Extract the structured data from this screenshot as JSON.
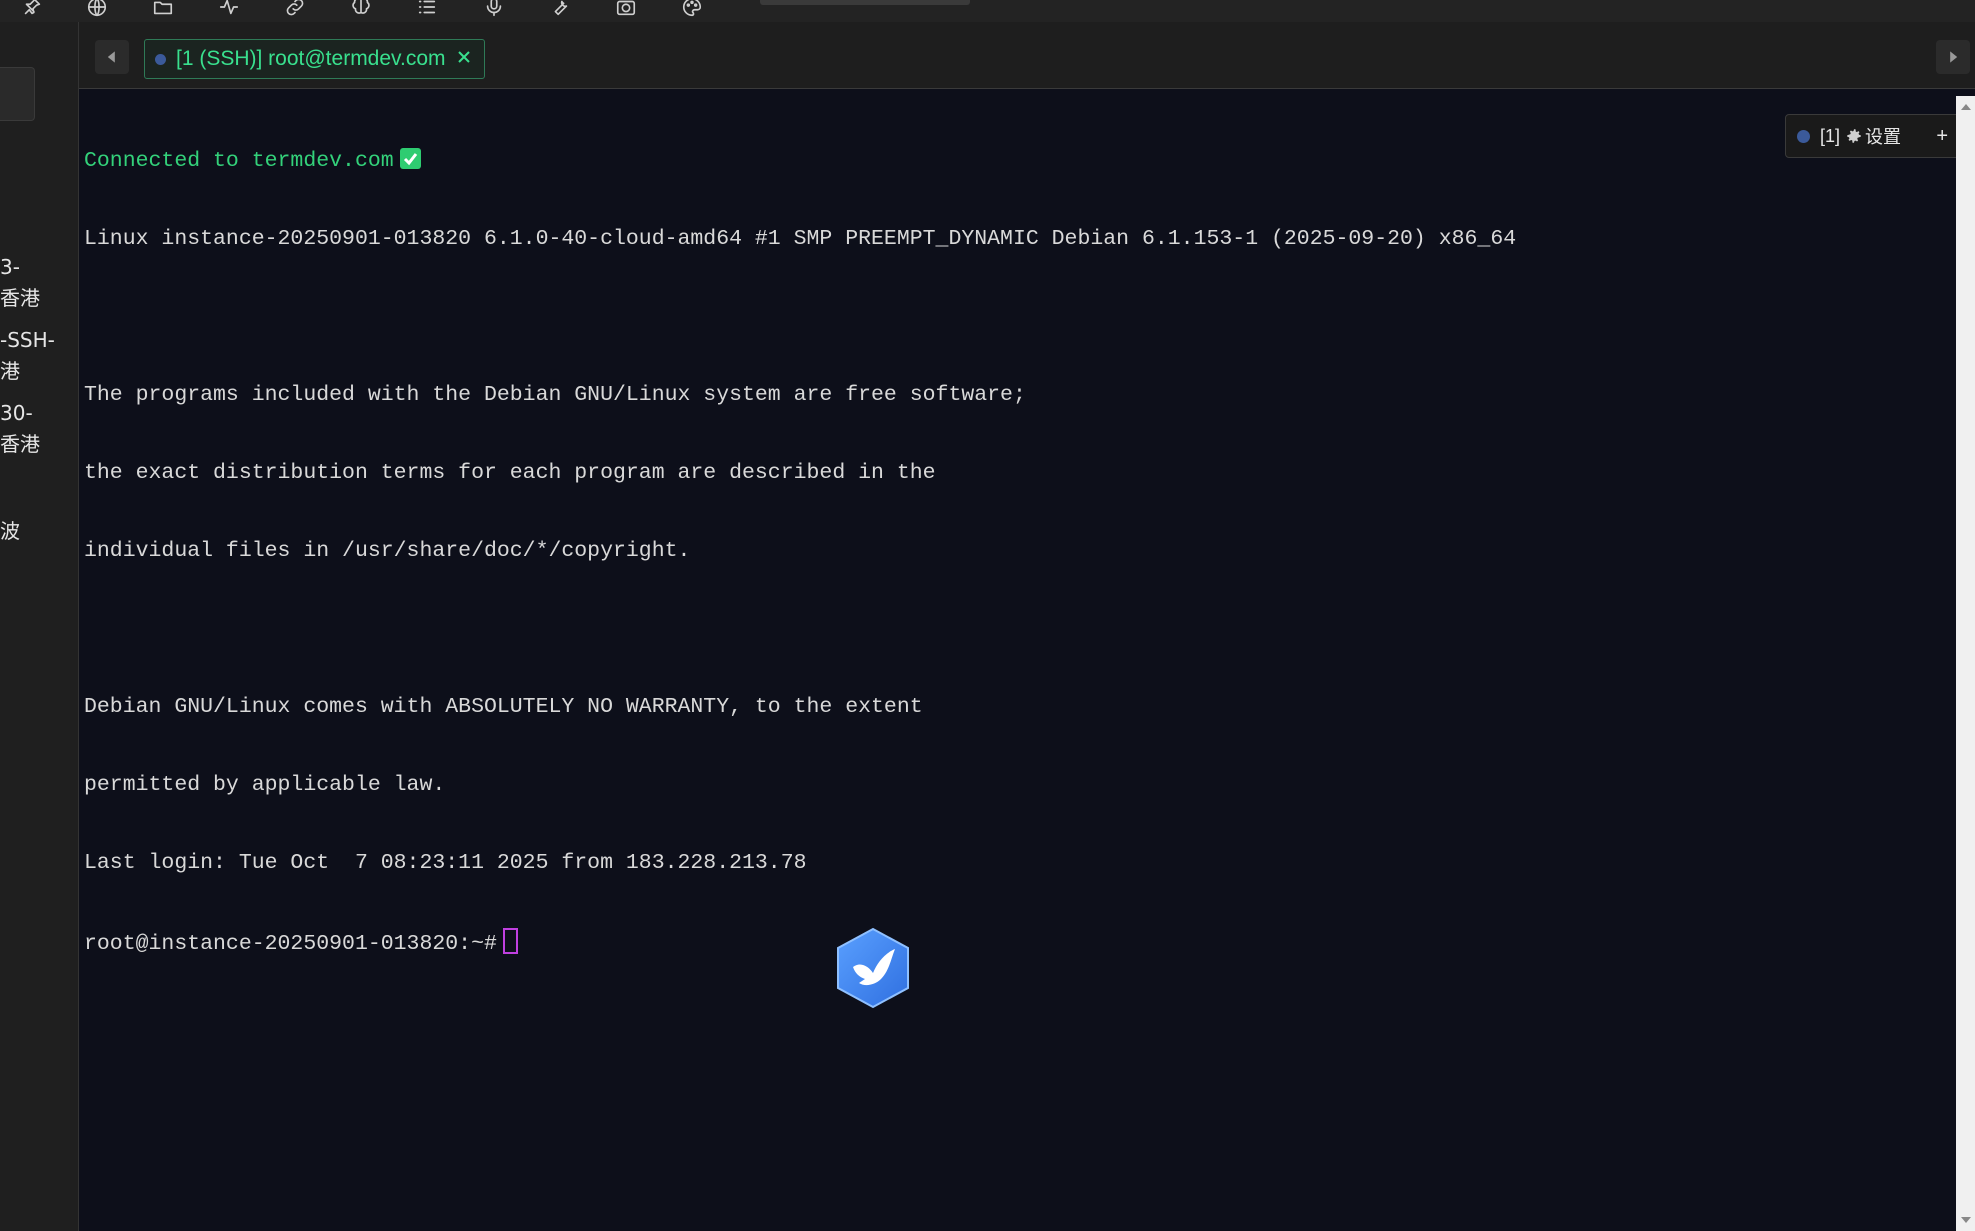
{
  "toolbar": {
    "icons": [
      "pin-icon",
      "globe-icon",
      "folder-icon",
      "activity-icon",
      "link-icon",
      "brain-icon",
      "list-icon",
      "microphone-icon",
      "wrench-icon",
      "camera-icon",
      "palette-icon"
    ]
  },
  "sidebar": {
    "fragments": [
      "3-",
      "香港",
      "-SSH-",
      "港",
      "30-",
      "香港",
      "波"
    ]
  },
  "tabbar": {
    "tab_label": "[1 (SSH)] root@termdev.com"
  },
  "terminal": {
    "connected": "Connected to termdev.com",
    "lines": [
      "Linux instance-20250901-013820 6.1.0-40-cloud-amd64 #1 SMP PREEMPT_DYNAMIC Debian 6.1.153-1 (2025-09-20) x86_64",
      "",
      "The programs included with the Debian GNU/Linux system are free software;",
      "the exact distribution terms for each program are described in the",
      "individual files in /usr/share/doc/*/copyright.",
      "",
      "Debian GNU/Linux comes with ABSOLUTELY NO WARRANTY, to the extent",
      "permitted by applicable law.",
      "Last login: Tue Oct  7 08:23:11 2025 from 183.228.213.78"
    ],
    "prompt": "root@instance-20250901-013820:~#"
  },
  "float_widget": {
    "index": "[1]",
    "settings_label": "设置",
    "add_label": "+"
  },
  "colors": {
    "terminal_bg": "#0d0f1a",
    "accent_green": "#33d17a",
    "cursor": "#c040e0"
  }
}
